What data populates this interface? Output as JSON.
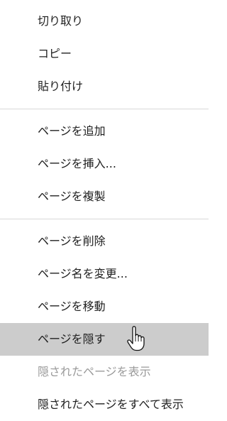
{
  "menu": {
    "group1": [
      {
        "label": "切り取り"
      },
      {
        "label": "コピー"
      },
      {
        "label": "貼り付け"
      }
    ],
    "group2": [
      {
        "label": "ページを追加"
      },
      {
        "label": "ページを挿入..."
      },
      {
        "label": "ページを複製"
      }
    ],
    "group3": [
      {
        "label": "ページを削除"
      },
      {
        "label": "ページ名を変更..."
      },
      {
        "label": "ページを移動"
      },
      {
        "label": "ページを隠す"
      },
      {
        "label": "隠されたページを表示"
      },
      {
        "label": "隠されたページをすべて表示"
      }
    ]
  },
  "state": {
    "hovered_item": "ページを隠す",
    "disabled_items": [
      "隠されたページを表示"
    ]
  },
  "colors": {
    "hover_bg": "#cccccc",
    "disabled_text": "#9a9a9a",
    "separator": "#d8d8d8"
  },
  "icons": {
    "cursor": "hand-pointer-icon"
  }
}
